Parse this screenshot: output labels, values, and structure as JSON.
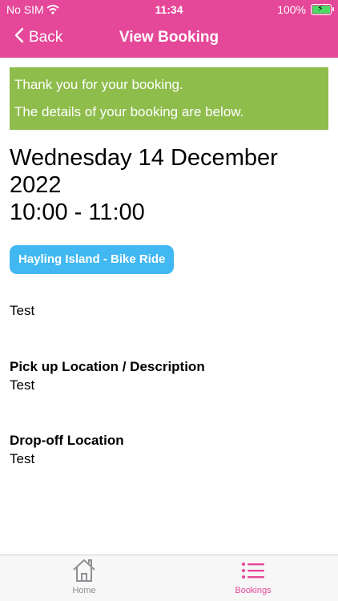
{
  "status_bar": {
    "carrier": "No SIM",
    "time": "11:34",
    "battery": "100%"
  },
  "nav": {
    "back_label": "Back",
    "title": "View Booking"
  },
  "banner": {
    "line1": "Thank you for your booking.",
    "line2": "The details of your booking are below."
  },
  "booking": {
    "date_line1": "Wednesday 14 December",
    "date_line2": "2022",
    "time_range": "10:00 - 11:00",
    "activity": "Hayling Island - Bike Ride",
    "notes": "Test",
    "pickup_heading": "Pick up Location / Description",
    "pickup_value": "Test",
    "dropoff_heading": "Drop-off Location",
    "dropoff_value": "Test"
  },
  "tabs": [
    {
      "label": "Home",
      "icon": "home-icon"
    },
    {
      "label": "Bookings",
      "icon": "list-icon",
      "active": true
    }
  ],
  "colors": {
    "brand": "#e54799",
    "success_banner": "#8fbd4c",
    "tag": "#41b8f2"
  }
}
